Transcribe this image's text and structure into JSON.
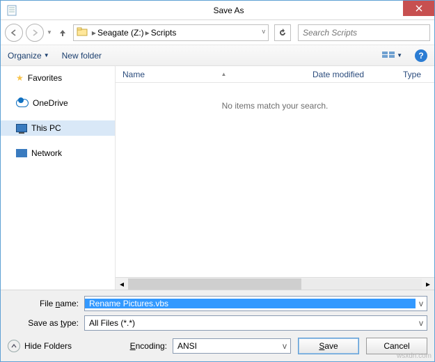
{
  "title": "Save As",
  "close_glyph": "✕",
  "breadcrumb": {
    "drive": "Seagate (Z:)",
    "folder": "Scripts"
  },
  "search": {
    "placeholder": "Search Scripts"
  },
  "toolbar": {
    "organize": "Organize",
    "newfolder": "New folder"
  },
  "columns": {
    "name": "Name",
    "date": "Date modified",
    "type": "Type"
  },
  "empty_msg": "No items match your search.",
  "sidebar": {
    "favorites": "Favorites",
    "onedrive": "OneDrive",
    "thispc": "This PC",
    "network": "Network"
  },
  "fields": {
    "filename_label": "File name:",
    "filename_value": "Rename Pictures.vbs",
    "savetype_label": "Save as type:",
    "savetype_value": "All Files  (*.*)",
    "encoding_label": "Encoding:",
    "encoding_value": "ANSI"
  },
  "buttons": {
    "hide_folders": "Hide Folders",
    "save": "Save",
    "cancel": "Cancel"
  },
  "watermark": "wsxdn.com"
}
